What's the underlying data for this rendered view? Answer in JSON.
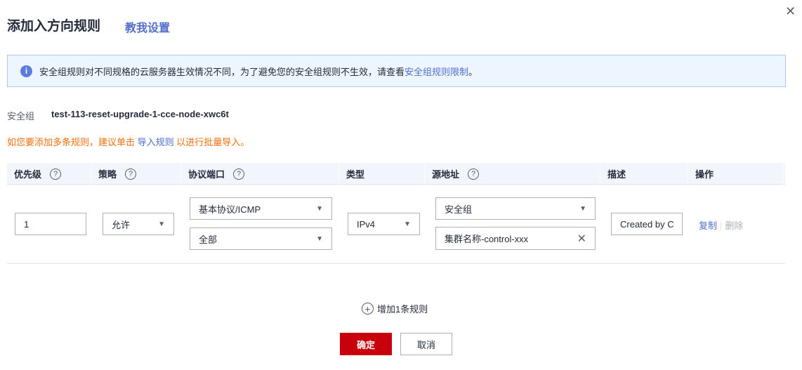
{
  "dialog": {
    "title": "添加入方向规则",
    "teach_link": "教我设置",
    "close": "✕"
  },
  "alert": {
    "text": "安全组规则对不同规格的云服务器生效情况不同，为了避免您的安全组规则不生效，请查看",
    "link": "安全组规则限制",
    "end": "。"
  },
  "security_group": {
    "label": "安全组",
    "value": "test-113-reset-upgrade-1-cce-node-xwc6t"
  },
  "tip": {
    "before": "如您要添加多条规则，建议单击 ",
    "link": "导入规则",
    "after": " 以进行批量导入。"
  },
  "columns": [
    "优先级",
    "策略",
    "协议端口",
    "类型",
    "源地址",
    "描述",
    "操作"
  ],
  "row": {
    "priority": "1",
    "policy": "允许",
    "protocol": "基本协议/ICMP",
    "port": "全部",
    "type": "IPv4",
    "source_type": "安全组",
    "source_value": "集群名称-control-xxx",
    "description": "Created by C",
    "copy": "复制",
    "delete": "删除"
  },
  "add_rule": "增加1条规则",
  "buttons": {
    "ok": "确定",
    "cancel": "取消"
  }
}
